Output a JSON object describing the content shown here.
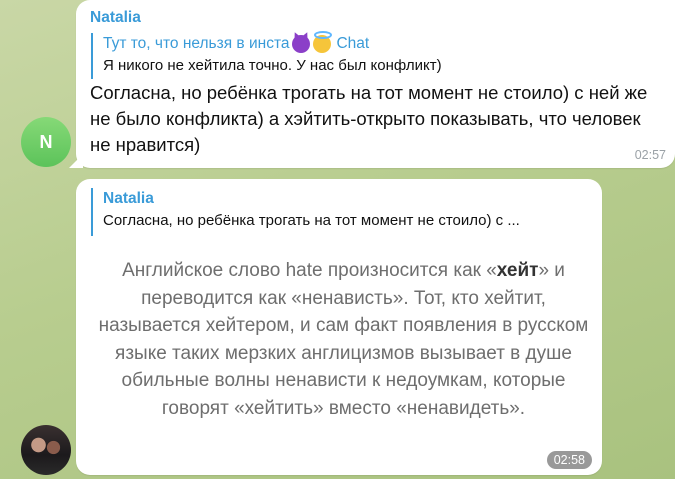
{
  "messages": [
    {
      "avatar_letter": "N",
      "sender": "Natalia",
      "reply": {
        "title": "Тут то, что нельзя в инста",
        "title_suffix": "Chat",
        "title_emoji_icons": [
          "smiling-devil-icon",
          "angel-face-icon"
        ],
        "text": "Я никого не хейтила точно. У нас был конфликт)"
      },
      "text": "Согласна, но ребёнка трогать на тот момент не стоило) с ней же не было конфликта) а хэйтить-открыто показывать, что человек не нравится)",
      "time": "02:57"
    },
    {
      "reply": {
        "title": "Natalia",
        "text": "Согласна, но ребёнка трогать на тот момент не стоило) с ..."
      },
      "quote": {
        "before": "Английское слово hate произносится как «",
        "bold": "хейт",
        "after": "» и переводится как «ненависть». Тот, кто хейтит, называется хейтером, и сам факт появления в русском языке таких мерзких англицизмов вызывает в душе обильные волны ненависти к недоумкам, которые говорят «хейтить» вместо «ненавидеть»."
      },
      "time": "02:58"
    }
  ],
  "colors": {
    "accent": "#3a9bd8",
    "avatar_green": "#5cc35a",
    "bubble": "#ffffff"
  }
}
